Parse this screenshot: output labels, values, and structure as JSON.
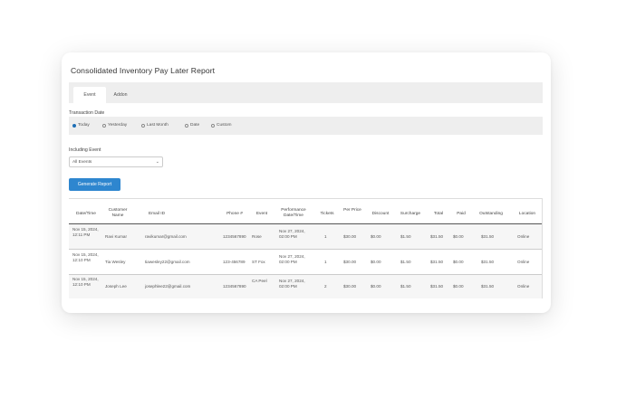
{
  "report": {
    "title": "Consolidated Inventory Pay Later Report",
    "tabs": [
      "Event",
      "Addon"
    ],
    "transaction_date_label": "Transaction Date",
    "date_options": [
      "Today",
      "Yesterday",
      "Last Month",
      "Date",
      "Custom"
    ],
    "selected_date_option": "Today",
    "event_label": "Including Event",
    "event_select_value": "All Events",
    "generate_button": "Generate Report"
  },
  "table": {
    "columns": [
      "Date/Time",
      "Customer Name",
      "Email ID",
      "Phone #",
      "Event",
      "Performance Date/Time",
      "Tickets",
      "Per Price",
      "Discount",
      "Surcharge",
      "Total",
      "Paid",
      "Outstanding",
      "Location"
    ],
    "rows": [
      [
        "Nov 15, 2024, 12:11 PM",
        "Ravi Kumar",
        "ravikumar@gmail.com",
        "1234567890",
        "Rose",
        "Nov 27, 2024, 02:00 PM",
        "1",
        "$30.00",
        "$0.00",
        "$1.50",
        "$31.50",
        "$0.00",
        "$31.50",
        "Online"
      ],
      [
        "Nov 15, 2024, 12:10 PM",
        "Tia Wesley",
        "tiawesley22@gmail.com",
        "123-456789",
        "ST Fox",
        "Nov 27, 2024, 02:00 PM",
        "1",
        "$30.00",
        "$0.00",
        "$1.50",
        "$31.50",
        "$0.00",
        "$31.50",
        "Online"
      ],
      [
        "Nov 15, 2024, 12:10 PM",
        "Joseph Lee",
        "josephlee22@gmail.com",
        "1234567890",
        "CA Peel",
        "Nov 27, 2024, 02:00 PM",
        "2",
        "$30.00",
        "$0.00",
        "$1.50",
        "$31.50",
        "$0.00",
        "$31.50",
        "Online"
      ]
    ]
  }
}
